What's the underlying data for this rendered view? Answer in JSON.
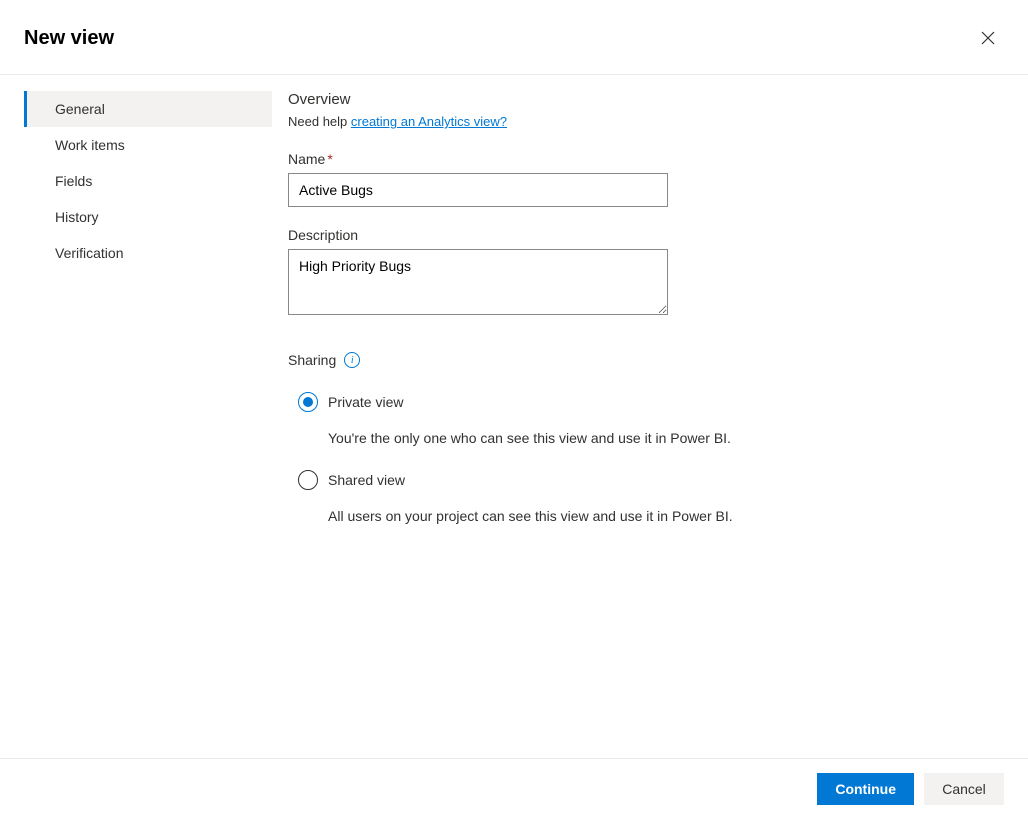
{
  "header": {
    "title": "New view"
  },
  "sidebar": {
    "items": [
      {
        "label": "General",
        "active": true
      },
      {
        "label": "Work items",
        "active": false
      },
      {
        "label": "Fields",
        "active": false
      },
      {
        "label": "History",
        "active": false
      },
      {
        "label": "Verification",
        "active": false
      }
    ]
  },
  "overview": {
    "title": "Overview",
    "help_prefix": "Need help ",
    "help_link": "creating an Analytics view?"
  },
  "fields": {
    "name_label": "Name",
    "name_value": "Active Bugs",
    "description_label": "Description",
    "description_value": "High Priority Bugs"
  },
  "sharing": {
    "label": "Sharing",
    "options": [
      {
        "label": "Private view",
        "description": "You're the only one who can see this view and use it in Power BI.",
        "checked": true
      },
      {
        "label": "Shared view",
        "description": "All users on your project can see this view and use it in Power BI.",
        "checked": false
      }
    ]
  },
  "footer": {
    "continue": "Continue",
    "cancel": "Cancel"
  }
}
